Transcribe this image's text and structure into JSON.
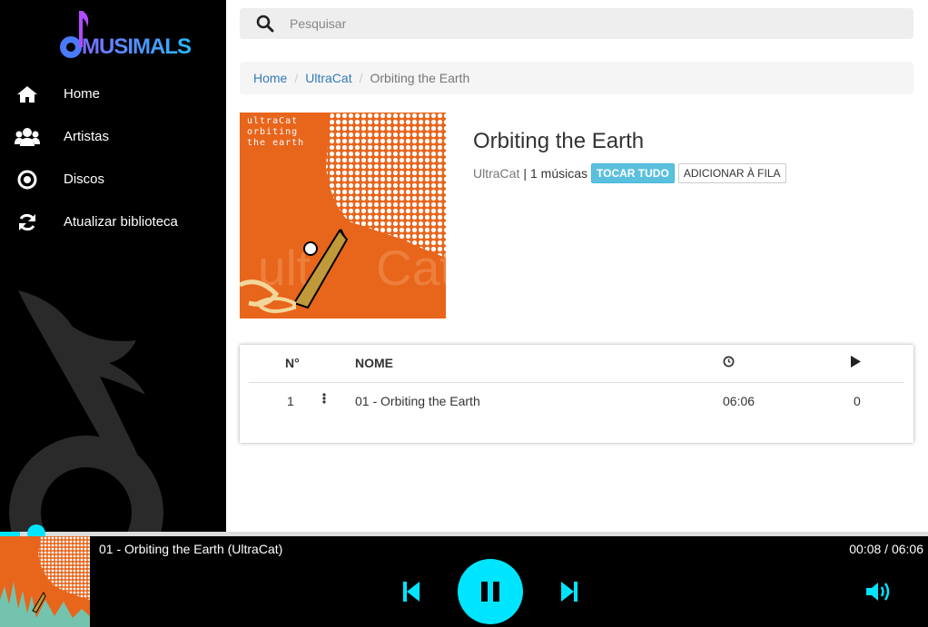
{
  "app": {
    "logo_text": "MUSIMALS"
  },
  "sidebar": {
    "items": [
      {
        "label": "Home",
        "icon": "home-icon"
      },
      {
        "label": "Artistas",
        "icon": "users-icon"
      },
      {
        "label": "Discos",
        "icon": "disc-icon"
      },
      {
        "label": "Atualizar biblioteca",
        "icon": "refresh-icon"
      }
    ]
  },
  "search": {
    "placeholder": "Pesquisar",
    "value": ""
  },
  "breadcrumb": {
    "home": "Home",
    "artist": "UltraCat",
    "current": "Orbiting the Earth"
  },
  "album": {
    "title": "Orbiting the Earth",
    "artist": "UltraCat",
    "separator": "|",
    "count": "1 músicas",
    "play_all": "TOCAR TUDO",
    "add_queue": "ADICIONAR À FILA",
    "cover_text": [
      "ultraCat",
      "orbiting",
      "the earth"
    ]
  },
  "tracks": {
    "headers": {
      "number": "N°",
      "name": "NOME",
      "duration_icon": "clock-icon",
      "plays_icon": "play-icon"
    },
    "rows": [
      {
        "number": "1",
        "name": "01 - Orbiting the Earth",
        "duration": "06:06",
        "plays": "0"
      }
    ]
  },
  "player": {
    "now_playing": "01 - Orbiting the Earth (UltraCat)",
    "time": "00:08 / 06:06",
    "progress": 0.022,
    "accent": "#00e5ff"
  }
}
